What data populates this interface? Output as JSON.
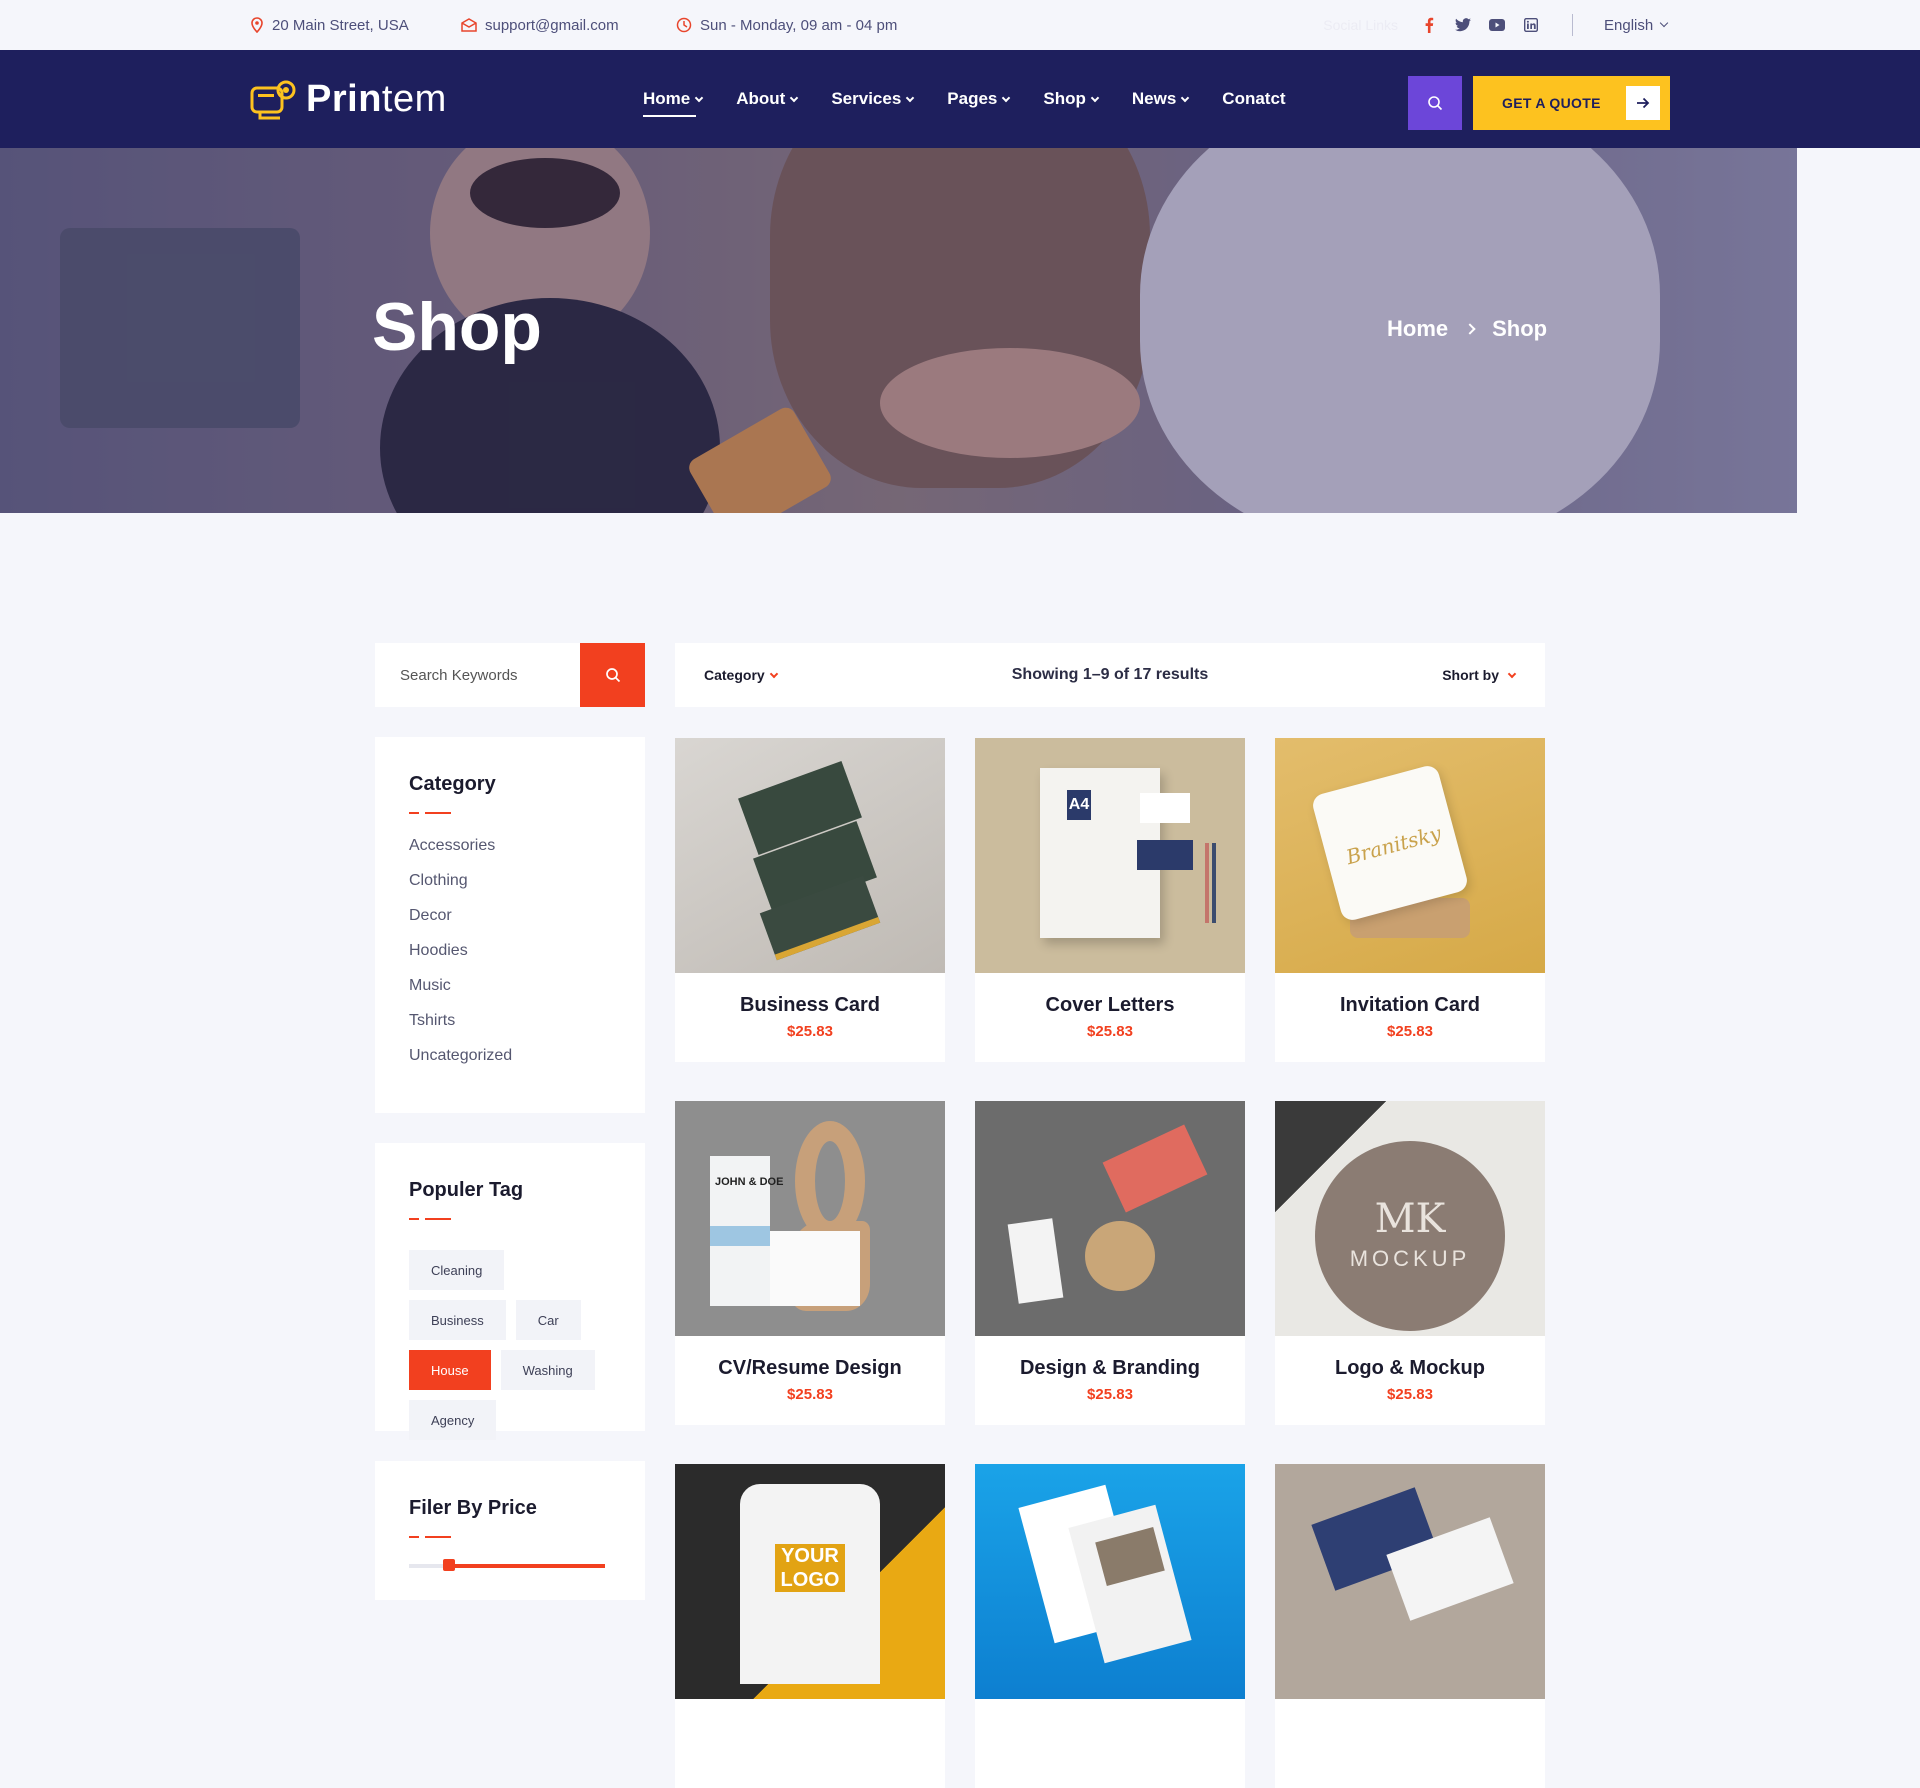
{
  "topbar": {
    "address": "20 Main Street, USA",
    "email": "support@gmail.com",
    "hours": "Sun - Monday, 09 am - 04 pm",
    "social_label": "Social Links",
    "language": "English"
  },
  "nav": {
    "logo_bold": "Prin",
    "logo_thin": "tem",
    "items": [
      {
        "label": "Home",
        "dropdown": true
      },
      {
        "label": "About",
        "dropdown": true
      },
      {
        "label": "Services",
        "dropdown": true
      },
      {
        "label": "Pages",
        "dropdown": true
      },
      {
        "label": "Shop",
        "dropdown": true
      },
      {
        "label": "News",
        "dropdown": true
      },
      {
        "label": "Conatct",
        "dropdown": false
      }
    ],
    "quote_label": "GET A QUOTE"
  },
  "hero": {
    "title": "Shop",
    "breadcrumb": [
      "Home",
      "Shop"
    ]
  },
  "sidebar": {
    "search_placeholder": "Search Keywords",
    "category_title": "Category",
    "categories": [
      "Accessories",
      "Clothing",
      "Decor",
      "Hoodies",
      "Music",
      "Tshirts",
      "Uncategorized"
    ],
    "tags_title": "Populer Tag",
    "tags": [
      "Cleaning",
      "Business",
      "Car",
      "House",
      "Washing",
      "Agency"
    ],
    "active_tag": "House",
    "price_title": "Filer By Price"
  },
  "toolbar": {
    "category_label": "Category",
    "results_text": "Showing 1–9 of 17 results",
    "sort_label": "Short by"
  },
  "products": [
    {
      "name": "Business Card",
      "price": "$25.83"
    },
    {
      "name": "Cover Letters",
      "price": "$25.83"
    },
    {
      "name": "Invitation Card",
      "price": "$25.83"
    },
    {
      "name": "CV/Resume Design",
      "price": "$25.83"
    },
    {
      "name": "Design & Branding",
      "price": "$25.83"
    },
    {
      "name": "Logo & Mockup",
      "price": "$25.83"
    },
    {
      "name": "",
      "price": ""
    },
    {
      "name": "",
      "price": ""
    },
    {
      "name": "",
      "price": ""
    }
  ],
  "mockup_text": {
    "card_name": "JOHN & DOE",
    "logo_mark": "MK",
    "logo_word": "MOCKUP",
    "tshirt_top": "YOUR",
    "tshirt_bottom": "LOGO",
    "a4": "A4",
    "script": "Branitsky"
  },
  "colors": {
    "nav_bg": "#1e1f5d",
    "accent": "#f2401f",
    "quote_bg": "#fdc21f",
    "search_purple": "#6c46d9"
  }
}
